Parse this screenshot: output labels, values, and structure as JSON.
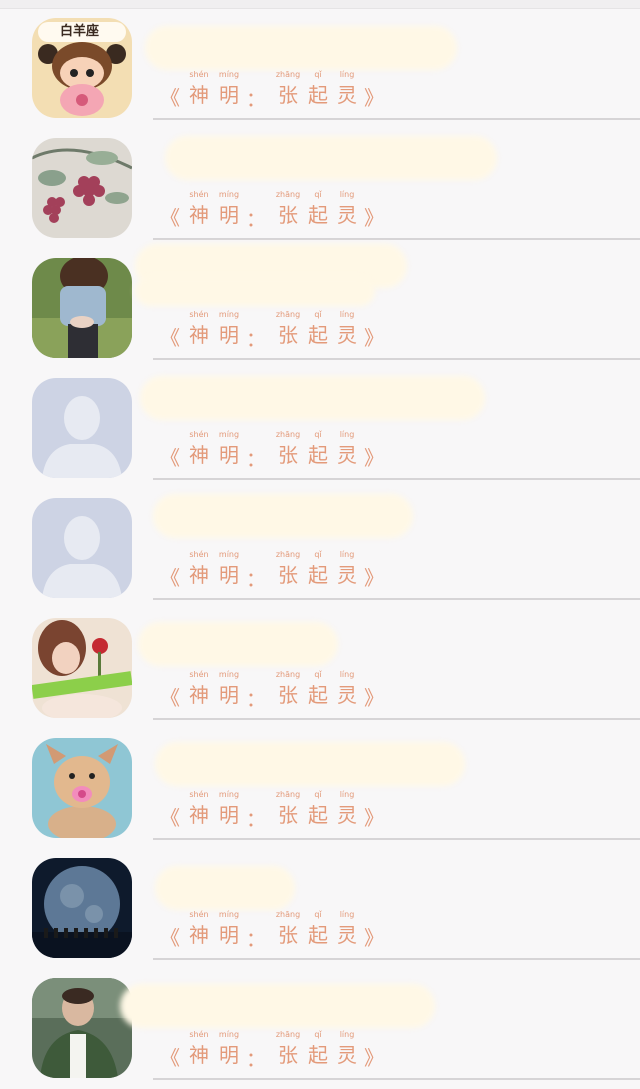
{
  "tagline": {
    "open": "《",
    "close": "》",
    "colon": "：",
    "chars": [
      "神",
      "明",
      "张",
      "起",
      "灵"
    ],
    "pinyin": [
      "shén",
      "míng",
      "zhāng",
      "qǐ",
      "líng"
    ]
  },
  "rows": [
    {
      "avatar_label": "白羊座",
      "avatar_icon": "zodiac-aries-avatar"
    },
    {
      "avatar_label": "",
      "avatar_icon": "grapes-avatar"
    },
    {
      "avatar_label": "",
      "avatar_icon": "girl-jeans-avatar"
    },
    {
      "avatar_label": "",
      "avatar_icon": "default-person-avatar"
    },
    {
      "avatar_label": "",
      "avatar_icon": "default-person-avatar"
    },
    {
      "avatar_label": "",
      "avatar_icon": "girl-rose-avatar"
    },
    {
      "avatar_label": "",
      "avatar_icon": "puppy-pacifier-avatar"
    },
    {
      "avatar_label": "",
      "avatar_icon": "earth-moon-avatar"
    },
    {
      "avatar_label": "",
      "avatar_icon": "man-jacket-avatar"
    }
  ],
  "colors": {
    "tagline": "#e39a7a",
    "name_blur": "#fff8e6",
    "divider": "#d6d4d6",
    "background": "#f8f7f8"
  }
}
